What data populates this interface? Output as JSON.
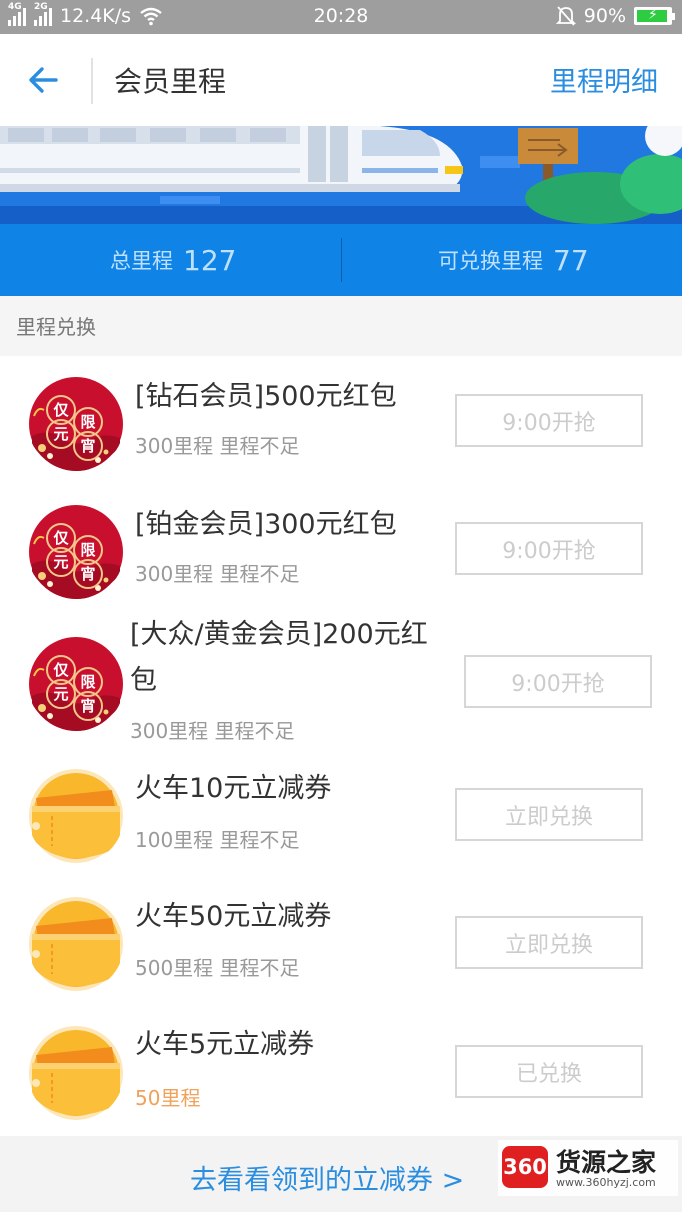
{
  "status_bar": {
    "signal1": "4G",
    "signal2": "2G",
    "speed": "12.4K/s",
    "time": "20:28",
    "battery": "90%",
    "icons": [
      "signal-icon",
      "wifi-icon",
      "mute-bell-icon",
      "battery-icon"
    ]
  },
  "header": {
    "title": "会员里程",
    "right_link": "里程明细",
    "back_icon": "back-arrow-icon"
  },
  "stats": {
    "total_label": "总里程",
    "total_value": "127",
    "redeemable_label": "可兑换里程",
    "redeemable_value": "77"
  },
  "section": {
    "title": "里程兑换"
  },
  "items": [
    {
      "title": "[钻石会员]500元红包",
      "sub": "300里程  里程不足",
      "button": "9:00开抢",
      "icon": "lantern-festival-badge-icon"
    },
    {
      "title": "[铂金会员]300元红包",
      "sub": "300里程  里程不足",
      "button": "9:00开抢",
      "icon": "lantern-festival-badge-icon"
    },
    {
      "title_line1": "[大众/黄金会员]200元红",
      "title_line2": "包",
      "sub": "300里程  里程不足",
      "button": "9:00开抢",
      "icon": "lantern-festival-badge-icon"
    },
    {
      "title": "火车10元立减券",
      "sub": "100里程  里程不足",
      "button": "立即兑换",
      "icon": "ticket-coupon-icon"
    },
    {
      "title": "火车50元立减券",
      "sub": "500里程  里程不足",
      "button": "立即兑换",
      "icon": "ticket-coupon-icon"
    },
    {
      "title": "火车5元立减券",
      "sub": "50里程",
      "button": "已兑换",
      "icon": "ticket-coupon-icon"
    }
  ],
  "badge_chars": [
    "仅",
    "限",
    "元",
    "宵"
  ],
  "bottom": {
    "link": "去看看领到的立减券 >"
  },
  "watermark": {
    "badge": "360",
    "text": "货源之家",
    "url": "www.360hyzj.com"
  },
  "colors": {
    "accent": "#2a8de0",
    "stats_bg": "#0f84e6",
    "badge_red": "#c8102e",
    "coupon_orange": "#f7b733",
    "exchanged_text": "#f0a15a"
  }
}
